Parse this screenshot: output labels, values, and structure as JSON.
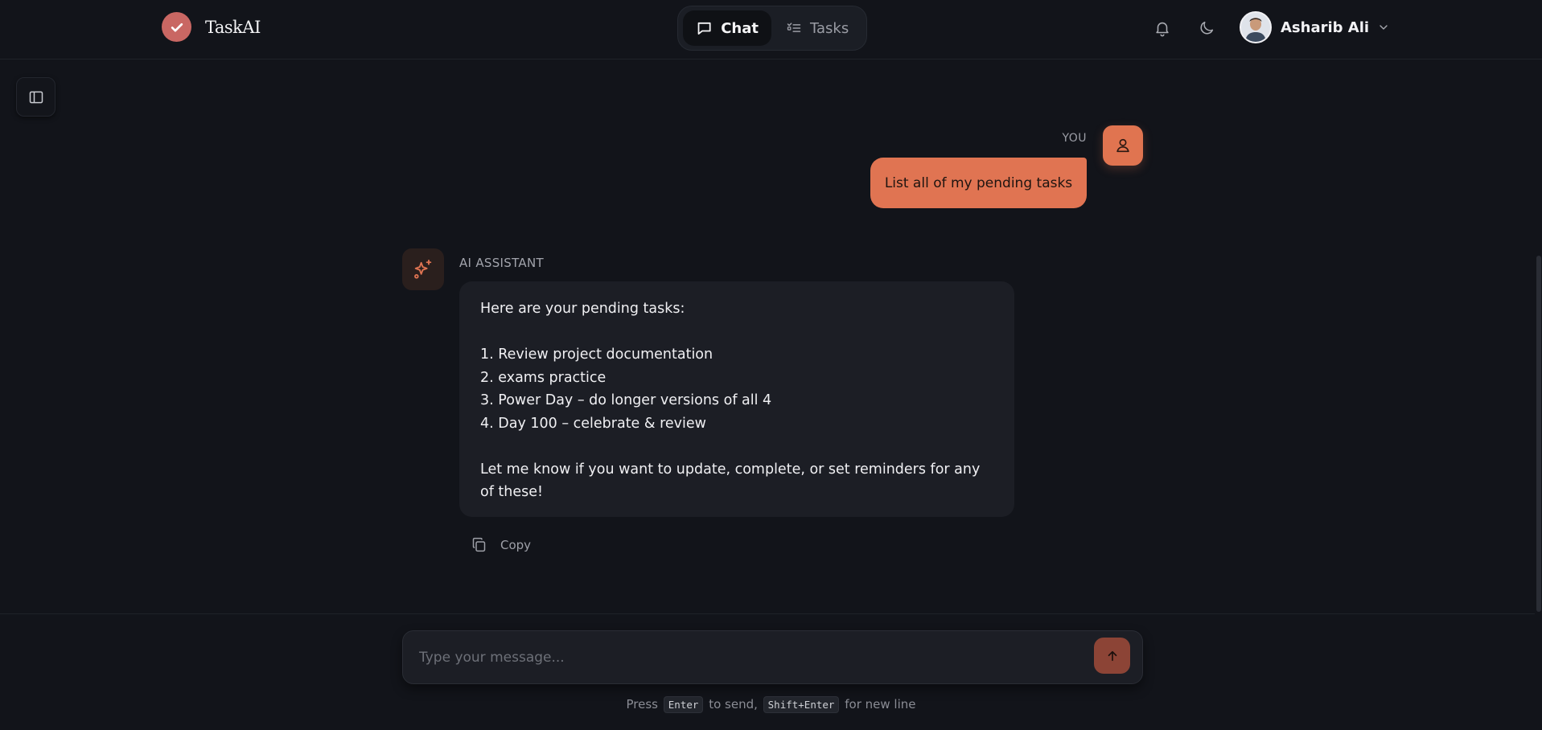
{
  "header": {
    "brand_name": "TaskAI",
    "nav": [
      {
        "label": "Chat",
        "active": true
      },
      {
        "label": "Tasks",
        "active": false
      }
    ],
    "user_name": "Asharib Ali",
    "icons": [
      "bell-icon",
      "moon-icon",
      "chevron-down-icon"
    ]
  },
  "chat": {
    "user_message": {
      "label": "YOU",
      "text": "List all of my pending tasks"
    },
    "ai_message": {
      "label": "AI ASSISTANT",
      "intro": "Here are your pending tasks:",
      "tasks": [
        "1. Review project documentation",
        "2. exams practice",
        "3. Power Day – do longer versions of all 4",
        "4. Day 100 – celebrate & review"
      ],
      "outro_line1": "Let me know if you want to update, complete, or set reminders for any",
      "outro_line2": "of these!"
    },
    "copy_label": "Copy"
  },
  "composer": {
    "placeholder": "Type your message...",
    "hint_press": "Press",
    "hint_enter_key": "Enter",
    "hint_to_send": "to send,",
    "hint_shift_enter_key": "Shift+Enter",
    "hint_new_line": "for new line"
  },
  "colors": {
    "accent": "#e07452",
    "background": "#12141a",
    "bubble": "#1c1e25"
  }
}
